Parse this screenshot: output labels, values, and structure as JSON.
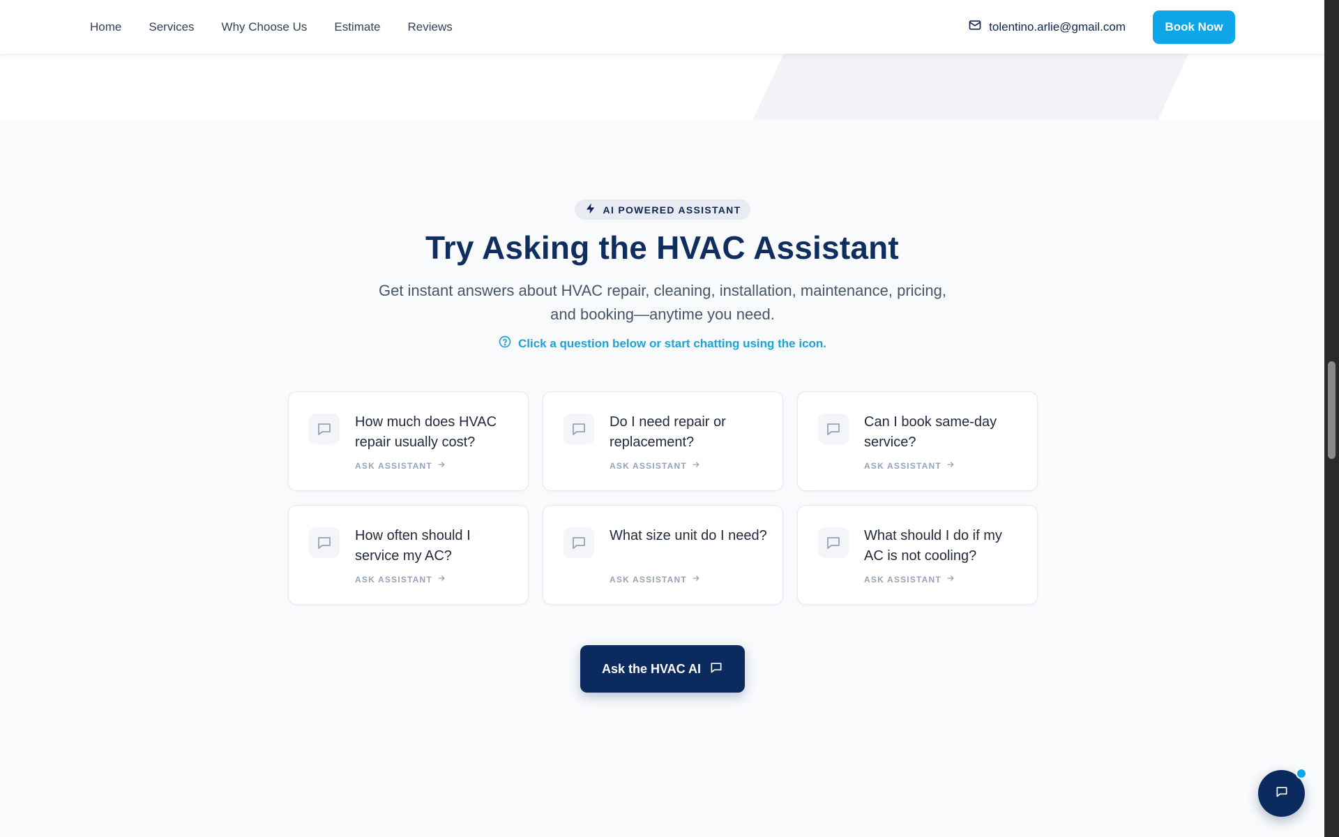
{
  "nav": {
    "links": [
      "Home",
      "Services",
      "Why Choose Us",
      "Estimate",
      "Reviews"
    ],
    "email": "tolentino.arlie@gmail.com",
    "book_label": "Book Now"
  },
  "assistant": {
    "badge": "AI POWERED ASSISTANT",
    "title": "Try Asking the HVAC Assistant",
    "subtitle": "Get instant answers about HVAC repair, cleaning, installation, maintenance, pricing, and booking—anytime you need.",
    "hint": "Click a question below or start chatting using the icon.",
    "cta_label": "ASK ASSISTANT",
    "questions": [
      "How much does HVAC repair usually cost?",
      "Do I need repair or replacement?",
      "Can I book same-day service?",
      "How often should I service my AC?",
      "What size unit do I need?",
      "What should I do if my AC is not cooling?"
    ],
    "ask_button": "Ask the HVAC AI"
  },
  "colors": {
    "navy": "#0b2a5e",
    "accent": "#0ea5e9",
    "hint": "#1ba3d6",
    "background": "#f8fafc"
  },
  "icons": {
    "email": "mail-icon",
    "badge": "lightning-icon",
    "hint": "question-circle-icon",
    "card": "chat-bubble-icon",
    "cta": "arrow-right-icon",
    "fab": "chat-bubble-icon"
  }
}
